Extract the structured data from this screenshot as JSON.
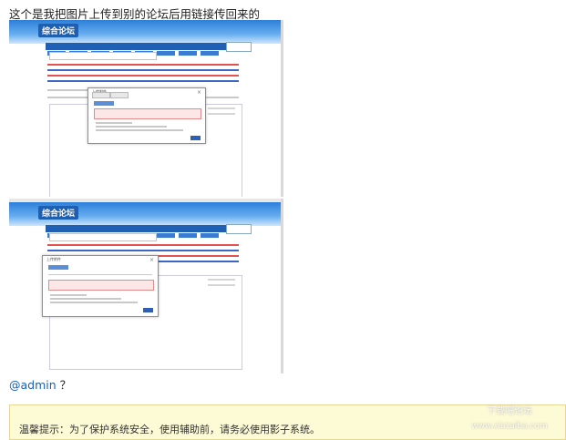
{
  "post": {
    "caption": "这个是我把图片上传到别的论坛后用链接传回来的",
    "mention": "@admin",
    "mention_suffix": "？"
  },
  "screenshots": [
    {
      "forum_logo": "综合论坛",
      "dialog_title": "上传附件"
    },
    {
      "forum_logo": "综合论坛",
      "dialog_title": "上传附件"
    }
  ],
  "tip": {
    "text": "温馨提示：为了保护系统安全，使用辅助前，请务必使用影子系统。"
  },
  "watermark": {
    "line1": "下载吧论坛",
    "line2": "www.xiazaiba.com"
  },
  "colors": {
    "link": "#1d5fb0",
    "tip_bg": "#fdfad6",
    "tip_border": "#e5d796"
  }
}
